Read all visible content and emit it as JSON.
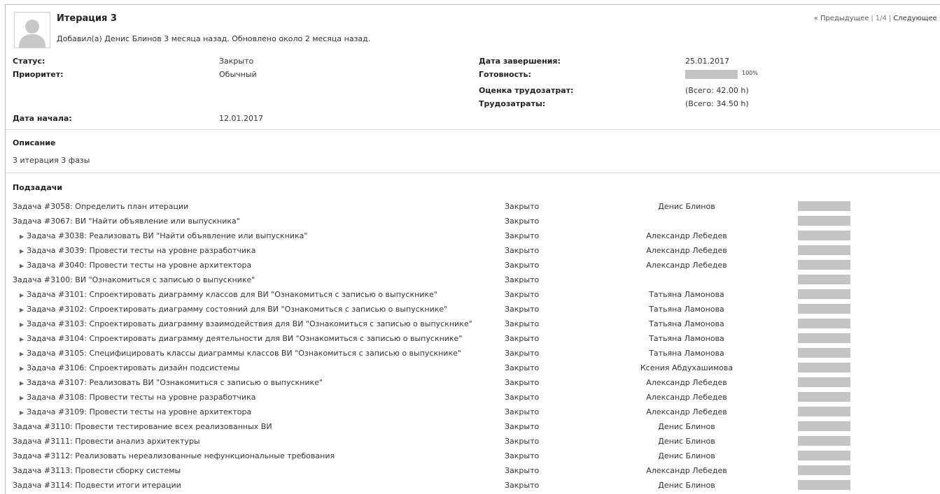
{
  "issue": {
    "title": "Итерация 3",
    "author_line": "Добавил(а) Денис Блинов 3 месяца назад. Обновлено около 2 месяца назад."
  },
  "pager": {
    "prev": "« Предыдущее",
    "position": "1/4",
    "next": "Следующее »"
  },
  "attributes": {
    "status_label": "Статус:",
    "status_value": "Закрыто",
    "priority_label": "Приоритет:",
    "priority_value": "Обычный",
    "start_label": "Дата начала:",
    "start_value": "12.01.2017",
    "due_label": "Дата завершения:",
    "due_value": "25.01.2017",
    "done_label": "Готовность:",
    "done_value": "100%",
    "done_ratio": 1.0,
    "estimate_label": "Оценка трудозатрат:",
    "estimate_value": "(Всего: 42.00 h)",
    "spent_label": "Трудозатраты:",
    "spent_value": "(Всего: 34.50 h)"
  },
  "description": {
    "heading": "Описание",
    "text": "3 итерация 3 фазы"
  },
  "subtasks": {
    "heading": "Подзадачи",
    "rows": [
      {
        "subject": "Задача #3058: Определить план итерации",
        "status": "Закрыто",
        "assignee": "Денис Блинов",
        "child": false,
        "done": 1.0
      },
      {
        "subject": "Задача #3067: ВИ \"Найти объявление или выпускника\"",
        "status": "Закрыто",
        "assignee": "",
        "child": false,
        "done": 1.0
      },
      {
        "subject": "Задача #3038: Реализовать ВИ \"Найти объявление или выпускника\"",
        "status": "Закрыто",
        "assignee": "Александр Лебедев",
        "child": true,
        "done": 1.0
      },
      {
        "subject": "Задача #3039: Провести тесты на уровне разработчика",
        "status": "Закрыто",
        "assignee": "Александр Лебедев",
        "child": true,
        "done": 1.0
      },
      {
        "subject": "Задача #3040: Провести тесты на уровне архитектора",
        "status": "Закрыто",
        "assignee": "Александр Лебедев",
        "child": true,
        "done": 1.0
      },
      {
        "subject": "Задача #3100: ВИ \"Ознакомиться с записью о выпускнике\"",
        "status": "Закрыто",
        "assignee": "",
        "child": false,
        "done": 1.0
      },
      {
        "subject": "Задача #3101: Спроектировать диаграмму классов для ВИ \"Ознакомиться с записью о выпускнике\"",
        "status": "Закрыто",
        "assignee": "Татьяна Ламонова",
        "child": true,
        "done": 1.0
      },
      {
        "subject": "Задача #3102: Спроектировать диаграмму состояний для ВИ \"Ознакомиться с записью о выпускнике\"",
        "status": "Закрыто",
        "assignee": "Татьяна Ламонова",
        "child": true,
        "done": 1.0
      },
      {
        "subject": "Задача #3103: Спроектировать диаграмму взаимодействия для ВИ \"Ознакомиться с записью о выпускнике\"",
        "status": "Закрыто",
        "assignee": "Татьяна Ламонова",
        "child": true,
        "done": 1.0
      },
      {
        "subject": "Задача #3104: Спроектировать диаграмму деятельности для ВИ \"Ознакомиться с записью о выпускнике\"",
        "status": "Закрыто",
        "assignee": "Татьяна Ламонова",
        "child": true,
        "done": 1.0
      },
      {
        "subject": "Задача #3105: Специфицировать классы диаграммы классов ВИ \"Ознакомиться с записью о выпускнике\"",
        "status": "Закрыто",
        "assignee": "Татьяна Ламонова",
        "child": true,
        "done": 1.0
      },
      {
        "subject": "Задача #3106: Спроектировать дизайн подсистемы",
        "status": "Закрыто",
        "assignee": "Ксения Абдухашимова",
        "child": true,
        "done": 1.0
      },
      {
        "subject": "Задача #3107: Реализовать ВИ \"Ознакомиться с записью о выпускнике\"",
        "status": "Закрыто",
        "assignee": "Александр Лебедев",
        "child": true,
        "done": 1.0
      },
      {
        "subject": "Задача #3108: Провести тесты на уровне разработчика",
        "status": "Закрыто",
        "assignee": "Александр Лебедев",
        "child": true,
        "done": 1.0
      },
      {
        "subject": "Задача #3109: Провести тесты на уровне архитектора",
        "status": "Закрыто",
        "assignee": "Александр Лебедев",
        "child": true,
        "done": 1.0
      },
      {
        "subject": "Задача #3110: Провести тестирование всех реализованных ВИ",
        "status": "Закрыто",
        "assignee": "Денис Блинов",
        "child": false,
        "done": 1.0
      },
      {
        "subject": "Задача #3111: Провести анализ архитектуры",
        "status": "Закрыто",
        "assignee": "Денис Блинов",
        "child": false,
        "done": 1.0
      },
      {
        "subject": "Задача #3112: Реализовать нереализованные нефункциональные требования",
        "status": "Закрыто",
        "assignee": "Денис Блинов",
        "child": false,
        "done": 1.0
      },
      {
        "subject": "Задача #3113: Провести сборку системы",
        "status": "Закрыто",
        "assignee": "Александр Лебедев",
        "child": false,
        "done": 1.0
      },
      {
        "subject": "Задача #3114: Подвести итоги итерации",
        "status": "Закрыто",
        "assignee": "Денис Блинов",
        "child": false,
        "done": 1.0
      }
    ]
  },
  "colors": {
    "progress_fill": "#c4c4c4",
    "divider": "#d6d6d6"
  }
}
